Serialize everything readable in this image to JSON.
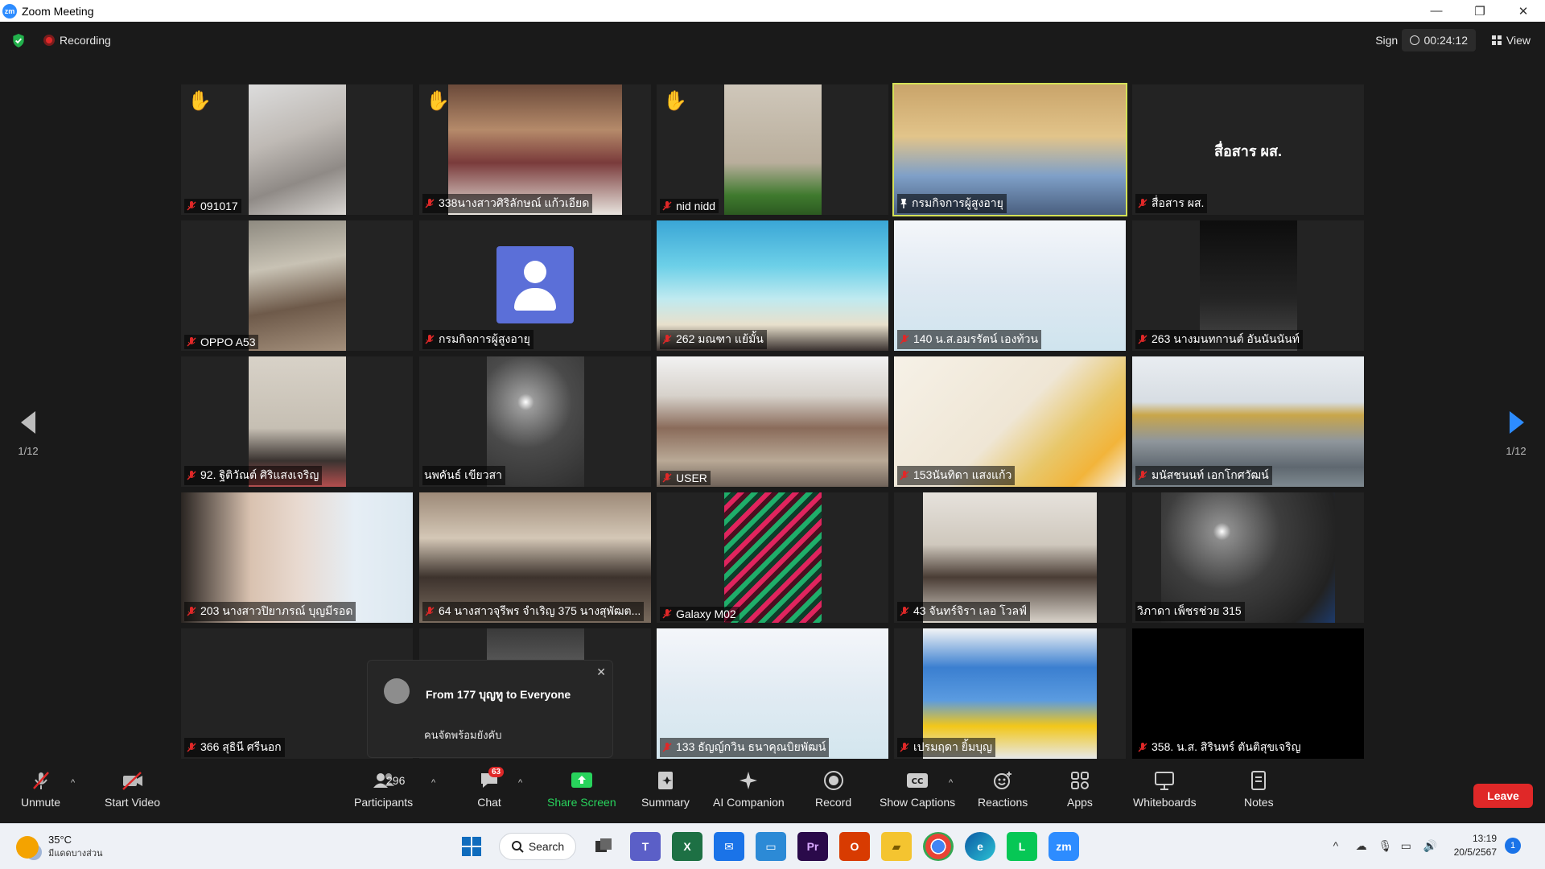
{
  "window": {
    "title": "Zoom Meeting",
    "logo_text": "zm",
    "minimize": "—",
    "restore": "❐",
    "close": "✕"
  },
  "topbar": {
    "recording_label": "Recording",
    "sign_in": "Sign in",
    "timer": "00:24:12",
    "view_label": "View"
  },
  "gallery": {
    "page_left": "1/12",
    "page_right": "1/12",
    "tiles": [
      {
        "name": "091017",
        "hand": true
      },
      {
        "name": "338นางสาวศิริลักษณ์ แก้วเอียด",
        "hand": true
      },
      {
        "name": "nid nidd",
        "hand": true
      },
      {
        "name": "กรมกิจการผู้สูงอายุ",
        "active": true,
        "pinned": true
      },
      {
        "name": "สื่อสาร ผส.",
        "title_text": "สื่อสาร ผส."
      },
      {
        "name": "OPPO A53"
      },
      {
        "name": "กรมกิจการผู้สูงอายุ"
      },
      {
        "name": "262 มณฑา แย้มั้น"
      },
      {
        "name": "140 น.ส.อมรรัตน์ เองท้วน"
      },
      {
        "name": "263 นางมนทกานต์ อันนันนันท์"
      },
      {
        "name": "92. ฐิติวัณต์ ศิริแสงเจริญ"
      },
      {
        "name": "นพคันธ์ เขียวสา",
        "muted": false
      },
      {
        "name": "USER"
      },
      {
        "name": "153นันทิดา แสงแก้ว"
      },
      {
        "name": "มนัสชนนท์ เอกโกศวัฒน์"
      },
      {
        "name": "203 นางสาวปิยาภรณ์ บุญมีรอด"
      },
      {
        "name": "64 นางสาวจุรีพร จำเริญ 375 นางสุพัฒต..."
      },
      {
        "name": "Galaxy M02"
      },
      {
        "name": "43 จันทร์จิรา เลอ โวลฟ์"
      },
      {
        "name": "วิภาดา เพ็ชรช่วย 315",
        "muted": false
      },
      {
        "name": "366 สุธินี ศรีนอก"
      },
      {
        "name": ""
      },
      {
        "name": "133 ธัญญ์กวิน ธนาคุณบิยพัฒน์"
      },
      {
        "name": "เปรมฤดา ยิ้มบุญ"
      },
      {
        "name": "358. น.ส. สิรินทร์ ตันติสุขเจริญ"
      }
    ]
  },
  "chat_popup": {
    "from": "From 177 บุญทู to Everyone",
    "message": "คนจัดพร้อมยังคับ",
    "close": "✕"
  },
  "toolbar": {
    "unmute": "Unmute",
    "start_video": "Start Video",
    "participants": "Participants",
    "participants_count": "296",
    "chat": "Chat",
    "chat_badge": "63",
    "share_screen": "Share Screen",
    "summary": "Summary",
    "ai_companion": "AI Companion",
    "record": "Record",
    "show_captions": "Show Captions",
    "reactions": "Reactions",
    "apps": "Apps",
    "whiteboards": "Whiteboards",
    "notes": "Notes",
    "leave": "Leave",
    "caret": "^"
  },
  "taskbar": {
    "temperature": "35°C",
    "weather_desc": "มีแดดบางส่วน",
    "search": "Search",
    "time": "13:19",
    "date": "20/5/2567",
    "notifications": "1",
    "pinned_apps": [
      "windows",
      "task-view",
      "teams",
      "excel",
      "mail",
      "remote-desktop",
      "premiere",
      "office",
      "file-explorer",
      "chrome",
      "edge",
      "line",
      "zoom"
    ]
  },
  "colors": {
    "accent_green": "#28d35c",
    "leave_red": "#e02828",
    "active_border": "#d4e157",
    "zoom_blue": "#2d8cff"
  }
}
